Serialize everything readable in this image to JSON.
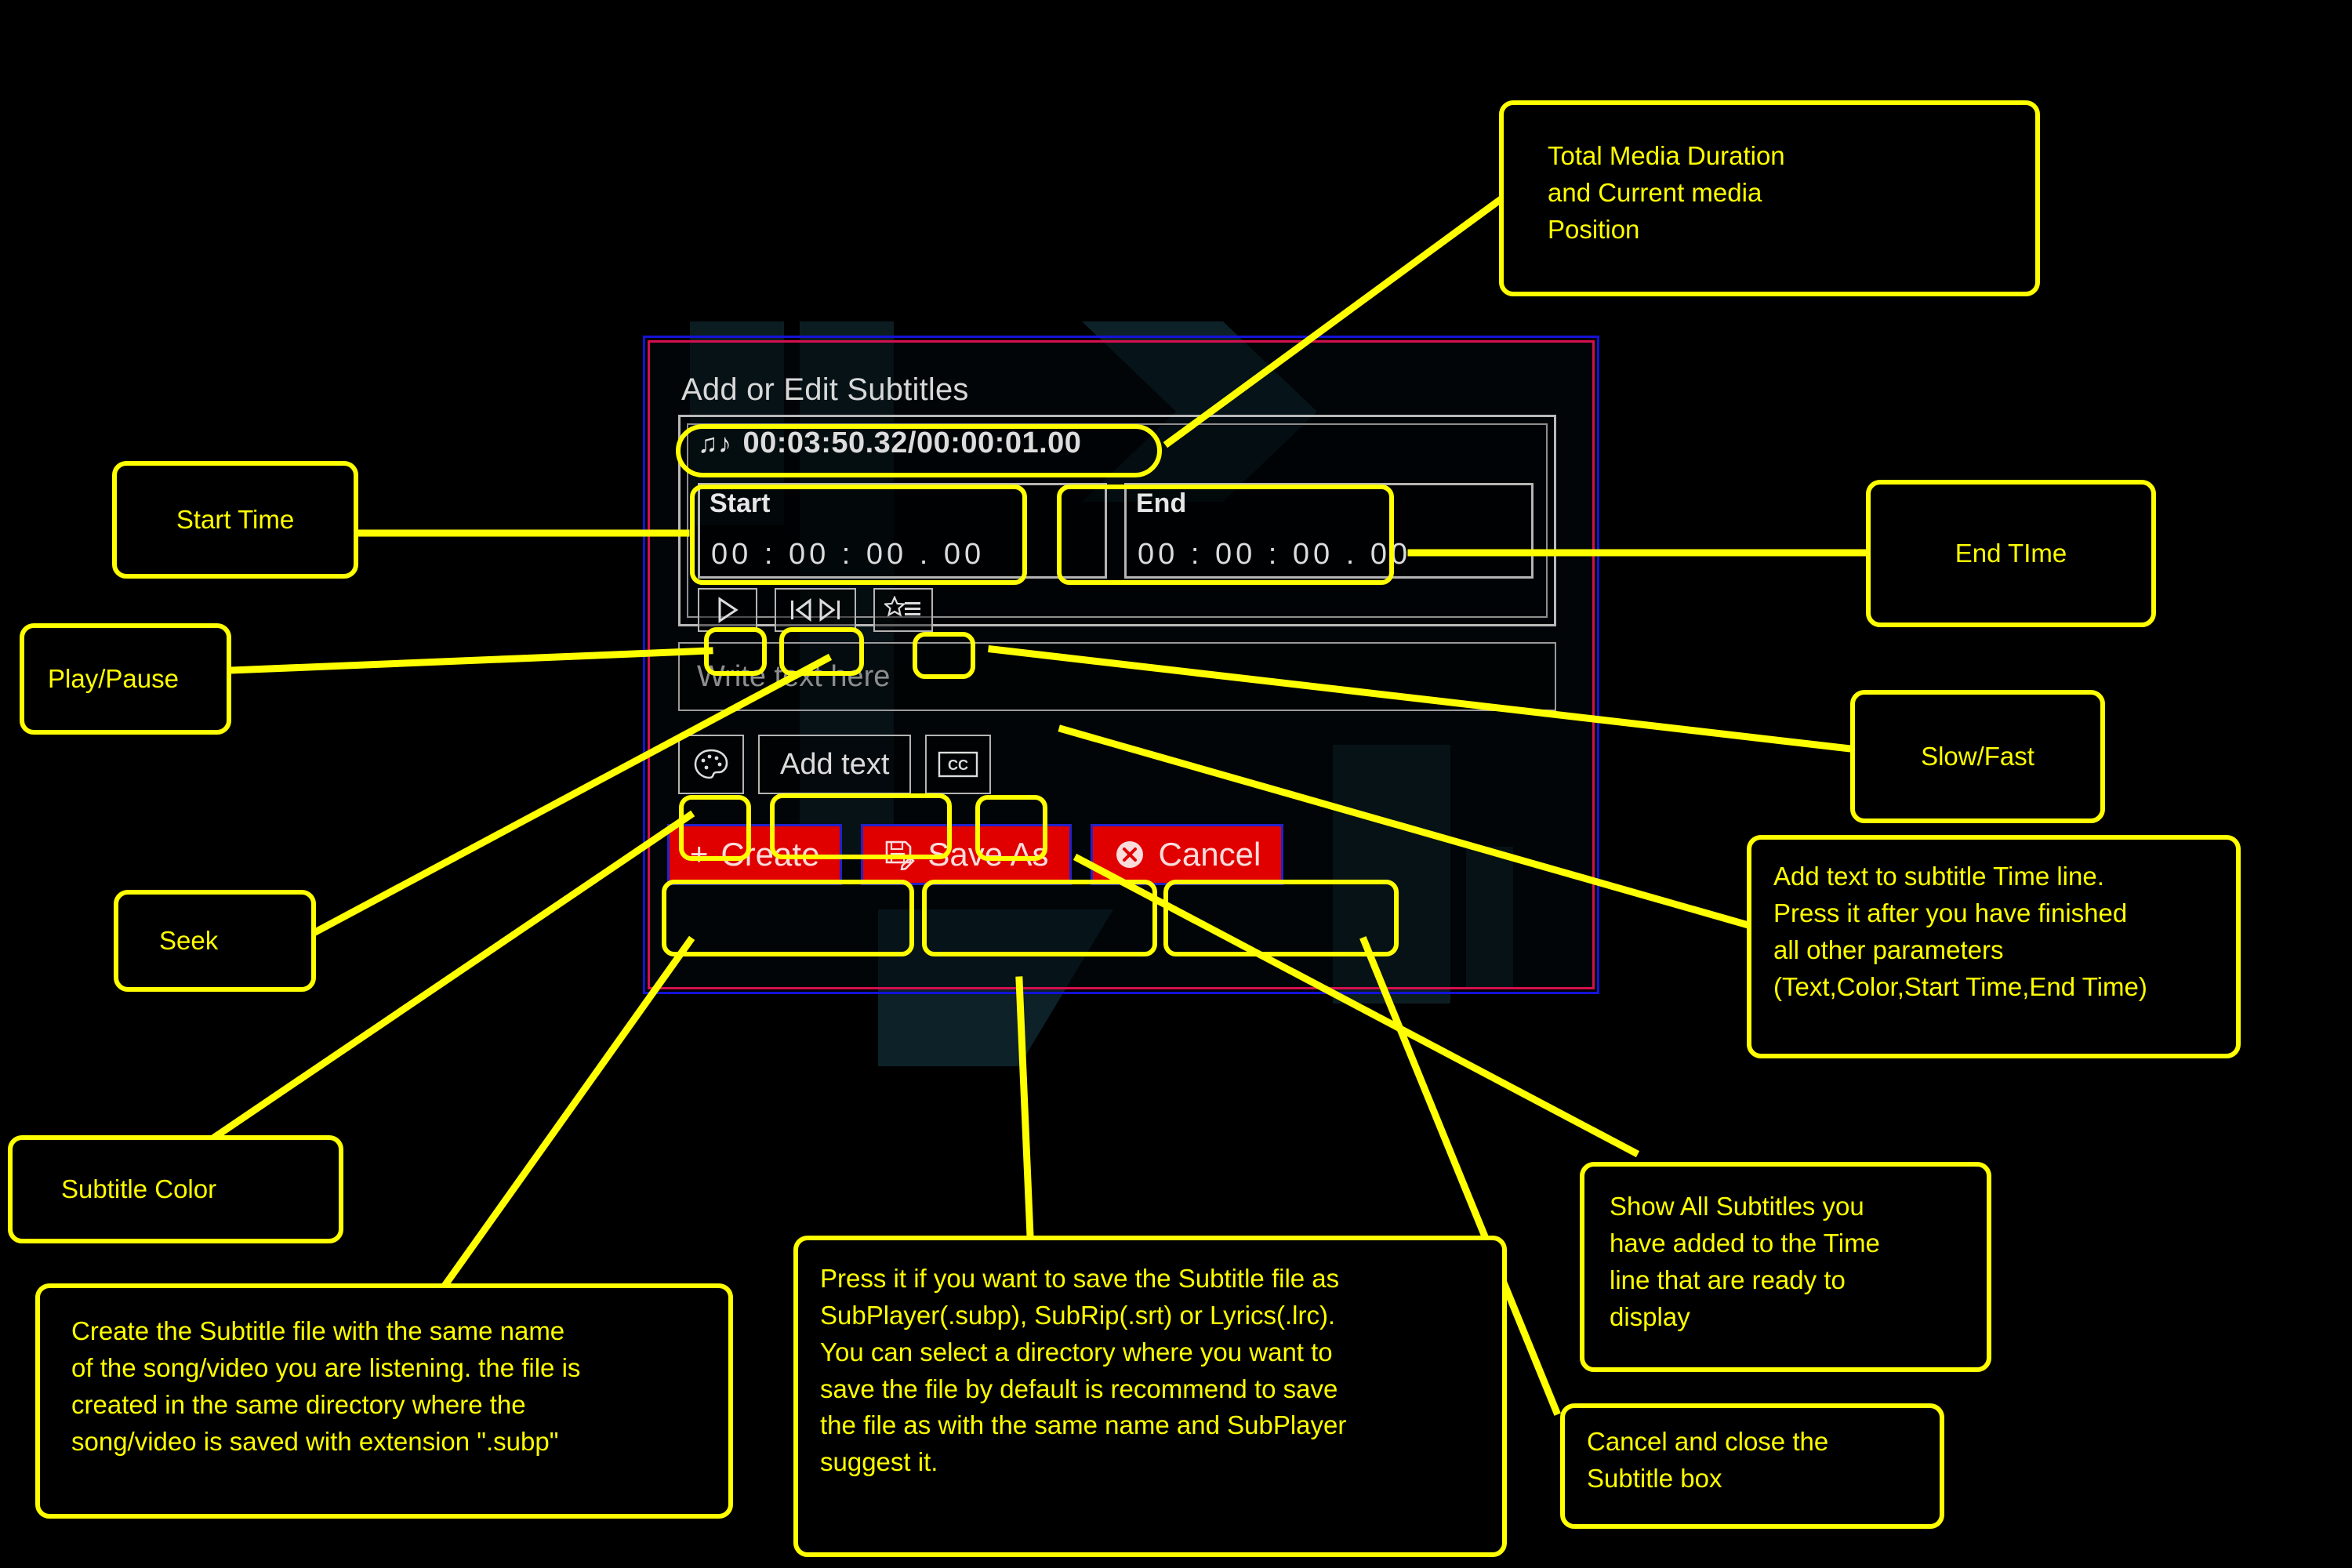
{
  "dialog": {
    "title": "Add or Edit Subtitles",
    "media_time": "00:03:50.32/00:00:01.00",
    "media_note_icon": "music-note-icon",
    "start": {
      "label": "Start",
      "value": "00 : 00 : 00 . 00"
    },
    "end": {
      "label": "End",
      "value": "00 : 00 : 00 . 00"
    },
    "transport": [
      {
        "name": "play-pause-button",
        "glyph": "▷"
      },
      {
        "name": "seek-button",
        "glyph": "|◁▷|"
      },
      {
        "name": "slow-fast-button",
        "glyph": "star-list-icon"
      }
    ],
    "text_input_placeholder": "Write text here",
    "actions": [
      {
        "name": "subtitle-color-button",
        "glyph": "palette-icon",
        "label": ""
      },
      {
        "name": "add-text-button",
        "glyph": "",
        "label": "Add text"
      },
      {
        "name": "show-subtitles-button",
        "glyph": "CC",
        "label": ""
      }
    ],
    "main_buttons": [
      {
        "name": "create-button",
        "glyph": "+",
        "label": "Create"
      },
      {
        "name": "save-as-button",
        "glyph": "💾",
        "label": "Save As"
      },
      {
        "name": "cancel-button",
        "glyph": "✖",
        "label": "Cancel"
      }
    ],
    "colors": {
      "outer_border": "#1313d8",
      "inner_border": "#d41050",
      "button_red": "#e00000",
      "button_border_blue": "#2222c8",
      "field_border": "#b4b4b4",
      "text": "#dcdcdc",
      "placeholder": "#8d8d8d"
    }
  },
  "annotations": {
    "accent": "#ffff00",
    "total_media_duration": "Total Media Duration\nand Current media\nPosition",
    "start_time": "Start Time",
    "end_time": "End TIme",
    "play_pause": "Play/Pause",
    "slow_fast": "Slow/Fast",
    "seek": "Seek",
    "add_text": "Add text to subtitle Time line.\nPress it after you have finished\nall other parameters\n(Text,Color,Start Time,End Time)",
    "subtitle_color": "Subtitle Color",
    "create": "Create the Subtitle file with the same name\nof the song/video you are listening. the file is\ncreated in the same directory where the\nsong/video is saved with extension \".subp\"",
    "save_as": "Press it if you want to save the Subtitle file as\nSubPlayer(.subp), SubRip(.srt) or Lyrics(.lrc).\nYou can select a directory where you want to\nsave the file by default is recommend to save\nthe file as with the same name and SubPlayer\nsuggest it.",
    "show_all": "Show All Subtitles you\nhave added to the Time\nline that are ready to\ndisplay",
    "cancel": "Cancel and close the\nSubtitle box"
  }
}
